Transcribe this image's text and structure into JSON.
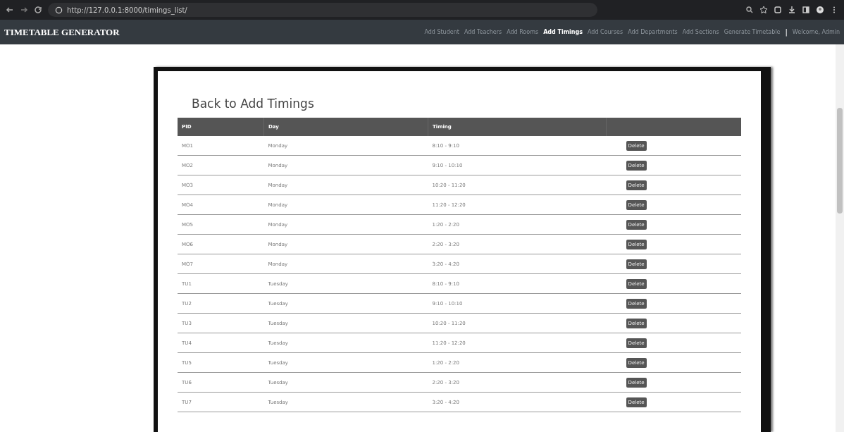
{
  "browser": {
    "url": "http://127.0.0.1:8000/timings_list/"
  },
  "navbar": {
    "brand": "TIMETABLE GENERATOR",
    "links": [
      {
        "label": "Add Student",
        "selected": false
      },
      {
        "label": "Add Teachers",
        "selected": false
      },
      {
        "label": "Add Rooms",
        "selected": false
      },
      {
        "label": "Add Timings",
        "selected": true
      },
      {
        "label": "Add Courses",
        "selected": false
      },
      {
        "label": "Add Departments",
        "selected": false
      },
      {
        "label": "Add Sections",
        "selected": false
      },
      {
        "label": "Generate Timetable",
        "selected": false
      }
    ],
    "separator": "|",
    "user": "Welcome, Admin"
  },
  "back_link": "Back to Add Timings",
  "table": {
    "columns": [
      "PID",
      "Day",
      "Timing"
    ],
    "rows": [
      {
        "cells": [
          "MO1",
          "Monday",
          "8:10 - 9:10"
        ],
        "action": "Delete"
      },
      {
        "cells": [
          "MO2",
          "Monday",
          "9:10 - 10:10"
        ],
        "action": "Delete"
      },
      {
        "cells": [
          "MO3",
          "Monday",
          "10:20 - 11:20"
        ],
        "action": "Delete"
      },
      {
        "cells": [
          "MO4",
          "Monday",
          "11:20 - 12:20"
        ],
        "action": "Delete"
      },
      {
        "cells": [
          "MO5",
          "Monday",
          "1:20 - 2:20"
        ],
        "action": "Delete"
      },
      {
        "cells": [
          "MO6",
          "Monday",
          "2:20 - 3:20"
        ],
        "action": "Delete"
      },
      {
        "cells": [
          "MO7",
          "Monday",
          "3:20 - 4:20"
        ],
        "action": "Delete"
      },
      {
        "cells": [
          "TU1",
          "Tuesday",
          "8:10 - 9:10"
        ],
        "action": "Delete"
      },
      {
        "cells": [
          "TU2",
          "Tuesday",
          "9:10 - 10:10"
        ],
        "action": "Delete"
      },
      {
        "cells": [
          "TU3",
          "Tuesday",
          "10:20 - 11:20"
        ],
        "action": "Delete"
      },
      {
        "cells": [
          "TU4",
          "Tuesday",
          "11:20 - 12:20"
        ],
        "action": "Delete"
      },
      {
        "cells": [
          "TU5",
          "Tuesday",
          "1:20 - 2:20"
        ],
        "action": "Delete"
      },
      {
        "cells": [
          "TU6",
          "Tuesday",
          "2:20 - 3:20"
        ],
        "action": "Delete"
      },
      {
        "cells": [
          "TU7",
          "Tuesday",
          "3:20 - 4:20"
        ],
        "action": "Delete"
      }
    ]
  }
}
